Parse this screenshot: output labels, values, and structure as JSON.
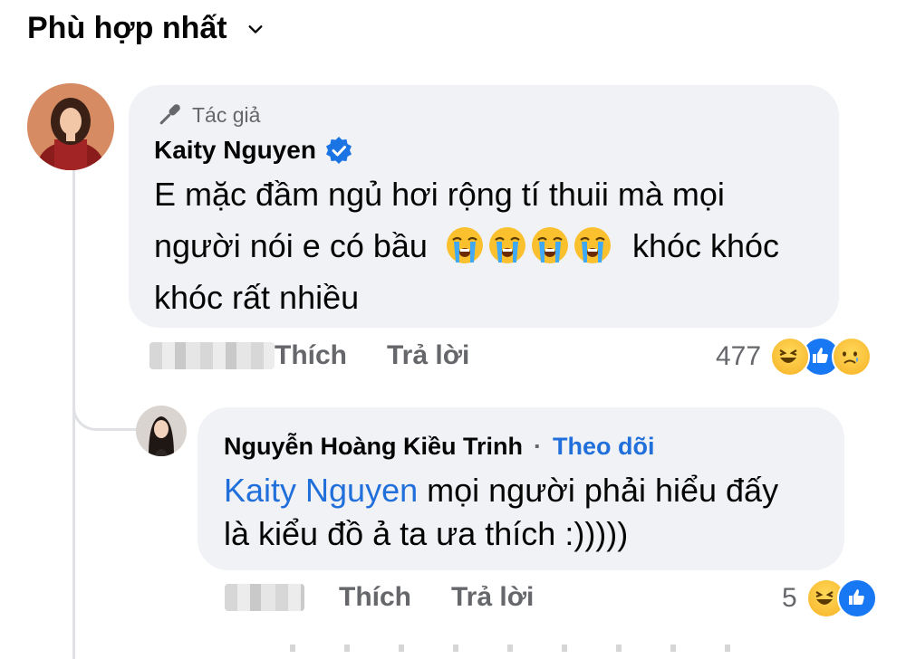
{
  "sort": {
    "label": "Phù hợp nhất"
  },
  "comment": {
    "author_badge": "Tác giả",
    "author_name": "Kaity Nguyen",
    "text_line1": "E mặc đầm ngủ hơi rộng tí thuii mà mọi",
    "text_line2_start": "người nói e có bầu",
    "text_line2_end": "khóc khóc",
    "text_line3": "khóc rất nhiều",
    "emoji_names": [
      "loudly-crying-face",
      "loudly-crying-face",
      "loudly-crying-face",
      "loudly-crying-face"
    ],
    "like_label": "Thích",
    "reply_label": "Trả lời",
    "reaction_count": "477",
    "reactions": [
      "haha",
      "like",
      "sad"
    ]
  },
  "reply": {
    "author_name": "Nguyễn Hoàng Kiều Trinh",
    "separator": "·",
    "follow_label": "Theo dõi",
    "mention": "Kaity Nguyen",
    "text_line1_rest": "mọi người phải hiểu đấy",
    "text_line2": "là kiểu đồ ả ta ưa thích :)))))",
    "like_label": "Thích",
    "reply_label": "Trả lời",
    "reaction_count": "5",
    "reactions": [
      "haha",
      "like"
    ]
  },
  "colors": {
    "link": "#216fdb",
    "bubble": "#f0f2f5",
    "muted": "#65676b",
    "verified": "#1b74e4"
  }
}
